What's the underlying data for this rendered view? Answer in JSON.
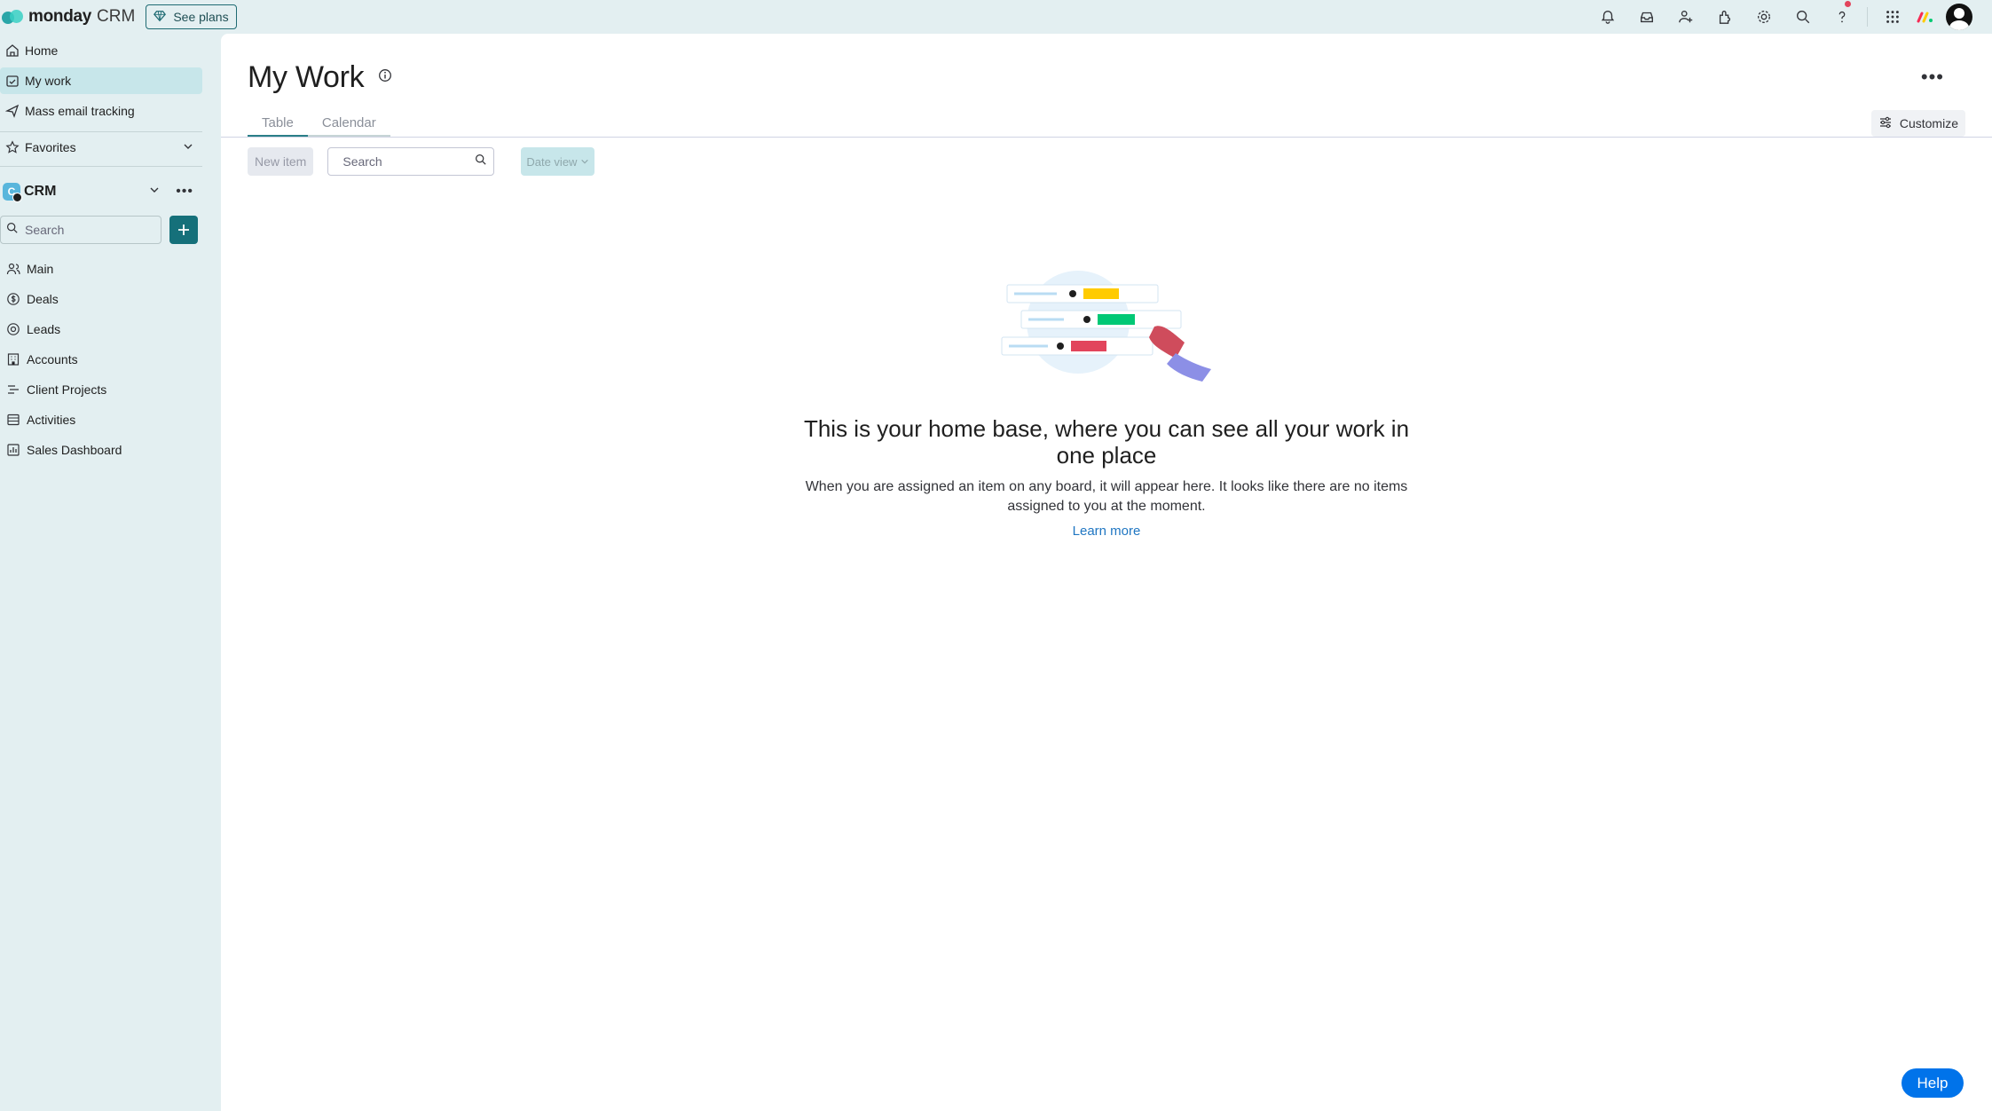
{
  "topbar": {
    "brand_name": "monday",
    "brand_product": "CRM",
    "see_plans_label": "See plans",
    "icons": [
      "bell-icon",
      "inbox-icon",
      "invite-user-icon",
      "apps-icon",
      "settings-icon",
      "search-icon",
      "help-question-icon",
      "app-grid-icon",
      "monday-mini-logo",
      "avatar"
    ]
  },
  "sidebar": {
    "items": [
      {
        "label": "Home",
        "icon": "home-icon"
      },
      {
        "label": "My work",
        "icon": "my-work-icon",
        "active": true
      },
      {
        "label": "Mass email tracking",
        "icon": "paper-plane-icon"
      }
    ],
    "favorites_label": "Favorites",
    "workspace": {
      "name": "CRM",
      "initial": "C"
    },
    "search_placeholder": "Search",
    "boards": [
      {
        "label": "Main",
        "icon": "people-icon"
      },
      {
        "label": "Deals",
        "icon": "dollar-icon"
      },
      {
        "label": "Leads",
        "icon": "target-icon"
      },
      {
        "label": "Accounts",
        "icon": "building-icon"
      },
      {
        "label": "Client Projects",
        "icon": "list-icon"
      },
      {
        "label": "Activities",
        "icon": "board-icon"
      },
      {
        "label": "Sales Dashboard",
        "icon": "dashboard-icon"
      }
    ]
  },
  "main": {
    "title": "My Work",
    "tabs": [
      {
        "label": "Table",
        "active": true
      },
      {
        "label": "Calendar"
      }
    ],
    "customize_label": "Customize",
    "new_item_label": "New item",
    "search_placeholder": "Search",
    "date_view_label": "Date view",
    "empty_title": "This is your home base, where you can see all your work in one place",
    "empty_desc": "When you are assigned an item on any board, it will appear here. It looks like there are no items assigned to you at the moment.",
    "learn_more_label": "Learn more",
    "help_label": "Help"
  },
  "colors": {
    "accent": "#15707a",
    "sidebar_bg": "#e3eff1",
    "active_item": "#c7e6ea",
    "link": "#1f76c2",
    "help": "#0073ea"
  }
}
